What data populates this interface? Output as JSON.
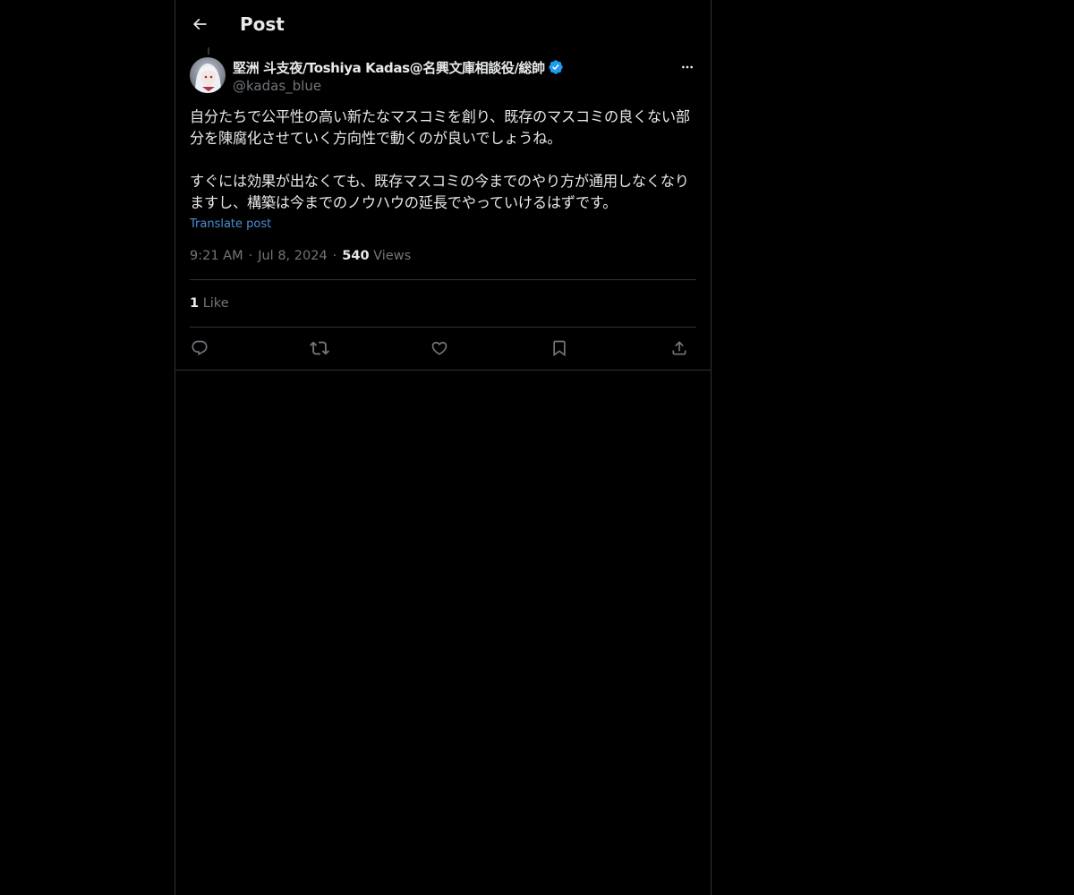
{
  "header": {
    "title": "Post",
    "back_icon": "arrow-left-icon"
  },
  "author": {
    "display_name": "堅洲 斗支夜/Toshiya Kadas@名興文庫相談役/総帥",
    "handle": "@kadas_blue",
    "verified": true,
    "verified_color": "#1d9bf0"
  },
  "post": {
    "text": "自分たちで公平性の高い新たなマスコミを創り、既存のマスコミの良くない部分を陳腐化させていく方向性で動くのが良いでしょうね。\n\nすぐには効果が出なくても、既存マスコミの今までのやり方が通用しなくなりますし、構築は今までのノウハウの延長でやっていけるはずです。",
    "translate_label": "Translate post",
    "time": "9:21 AM",
    "date": "Jul 8, 2024",
    "views_count": "540",
    "views_label": "Views",
    "separator": "·"
  },
  "engagement": {
    "likes_count": "1",
    "likes_label": "Like"
  },
  "actions": {
    "reply_icon": "reply-icon",
    "repost_icon": "repost-icon",
    "like_icon": "heart-icon",
    "bookmark_icon": "bookmark-icon",
    "share_icon": "share-icon"
  },
  "colors": {
    "background": "#000000",
    "text": "#e7e9ea",
    "muted": "#71767b",
    "border": "#2f3336",
    "link": "#1d9bf0"
  }
}
